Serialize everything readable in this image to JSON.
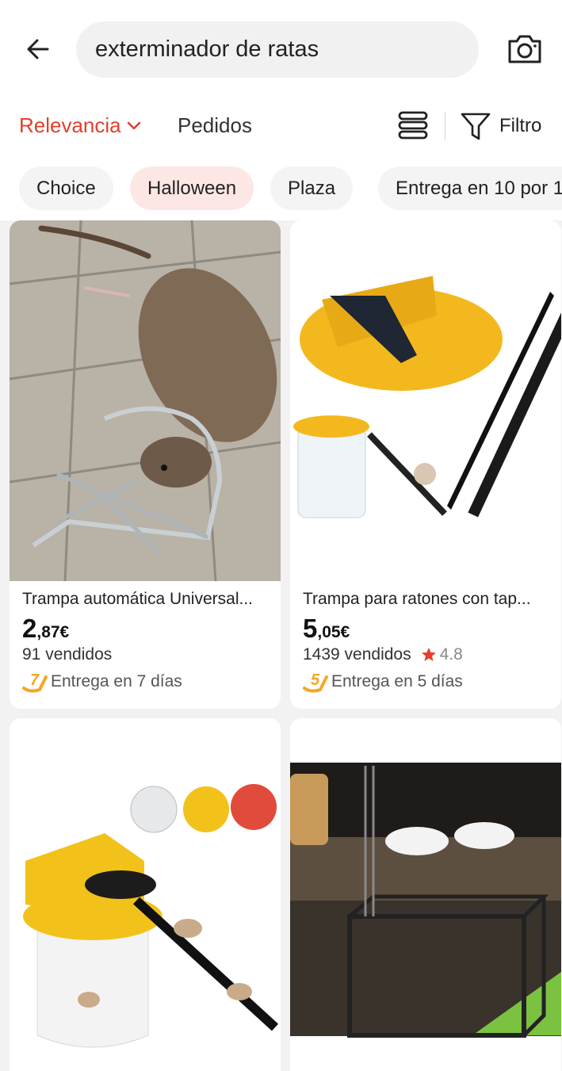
{
  "search": {
    "query": "exterminador de ratas"
  },
  "sort": {
    "relevance_label": "Relevancia",
    "orders_label": "Pedidos",
    "filter_label": "Filtro"
  },
  "chips": [
    "Choice",
    "Halloween",
    "Plaza",
    "Entrega en 10 por 1"
  ],
  "products": [
    {
      "title": "Trampa automática Universal...",
      "price_int": "2",
      "price_dec": ",87€",
      "sold": "91 vendidos",
      "rating": "",
      "delivery": "Entrega en 7 días",
      "delivery_badge": "7"
    },
    {
      "title": "Trampa para ratones con tap...",
      "price_int": "5",
      "price_dec": ",05€",
      "sold": "1439 vendidos",
      "rating": "4.8",
      "delivery": "Entrega en 5 días",
      "delivery_badge": "5"
    }
  ],
  "colors": {
    "accent": "#e0412c",
    "delivery_badge": "#f5a623",
    "star": "#e0412c",
    "active_chip": "#fde7e5"
  },
  "icons": [
    "back-arrow-icon",
    "camera-icon",
    "chevron-down-icon",
    "list-view-icon",
    "filter-icon",
    "star-icon"
  ]
}
